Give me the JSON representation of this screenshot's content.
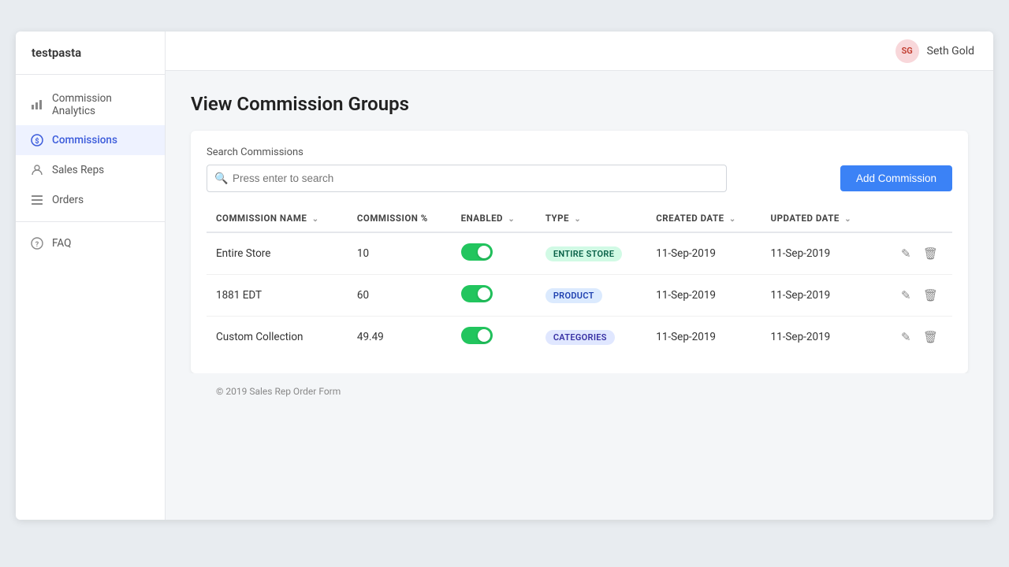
{
  "app": {
    "name": "testpasta"
  },
  "topbar": {
    "user_initials": "SG",
    "user_name": "Seth Gold"
  },
  "sidebar": {
    "items": [
      {
        "id": "commission-analytics",
        "label": "Commission Analytics",
        "icon": "chart-icon",
        "active": false
      },
      {
        "id": "commissions",
        "label": "Commissions",
        "icon": "dollar-icon",
        "active": true
      },
      {
        "id": "sales-reps",
        "label": "Sales Reps",
        "icon": "person-icon",
        "active": false
      },
      {
        "id": "orders",
        "label": "Orders",
        "icon": "list-icon",
        "active": false
      }
    ],
    "faq": {
      "label": "FAQ",
      "icon": "question-icon"
    }
  },
  "page": {
    "title": "View Commission Groups"
  },
  "search": {
    "label": "Search Commissions",
    "placeholder": "Press enter to search",
    "value": ""
  },
  "add_button": "Add Commission",
  "table": {
    "columns": [
      {
        "key": "name",
        "label": "Commission Name",
        "sortable": true
      },
      {
        "key": "percent",
        "label": "Commission %",
        "sortable": false
      },
      {
        "key": "enabled",
        "label": "Enabled",
        "sortable": true
      },
      {
        "key": "type",
        "label": "Type",
        "sortable": true
      },
      {
        "key": "created_date",
        "label": "Created Date",
        "sortable": true
      },
      {
        "key": "updated_date",
        "label": "Updated Date",
        "sortable": true
      }
    ],
    "rows": [
      {
        "name": "Entire Store",
        "percent": "10",
        "enabled": true,
        "type": "ENTIRE STORE",
        "type_class": "entire-store",
        "created_date": "11-Sep-2019",
        "updated_date": "11-Sep-2019"
      },
      {
        "name": "1881 EDT",
        "percent": "60",
        "enabled": true,
        "type": "PRODUCT",
        "type_class": "product",
        "created_date": "11-Sep-2019",
        "updated_date": "11-Sep-2019"
      },
      {
        "name": "Custom Collection",
        "percent": "49.49",
        "enabled": true,
        "type": "CATEGORIES",
        "type_class": "categories",
        "created_date": "11-Sep-2019",
        "updated_date": "11-Sep-2019"
      }
    ]
  },
  "footer": {
    "text": "© 2019 Sales Rep Order Form"
  }
}
